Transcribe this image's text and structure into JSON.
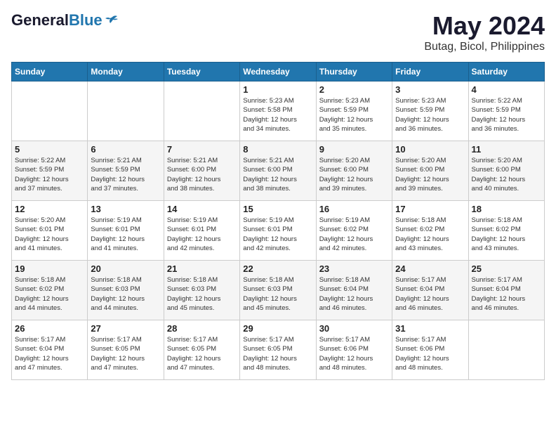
{
  "header": {
    "logo_general": "General",
    "logo_blue": "Blue",
    "title": "May 2024",
    "subtitle": "Butag, Bicol, Philippines"
  },
  "weekdays": [
    "Sunday",
    "Monday",
    "Tuesday",
    "Wednesday",
    "Thursday",
    "Friday",
    "Saturday"
  ],
  "weeks": [
    [
      {
        "day": "",
        "info": ""
      },
      {
        "day": "",
        "info": ""
      },
      {
        "day": "",
        "info": ""
      },
      {
        "day": "1",
        "info": "Sunrise: 5:23 AM\nSunset: 5:58 PM\nDaylight: 12 hours\nand 34 minutes."
      },
      {
        "day": "2",
        "info": "Sunrise: 5:23 AM\nSunset: 5:59 PM\nDaylight: 12 hours\nand 35 minutes."
      },
      {
        "day": "3",
        "info": "Sunrise: 5:23 AM\nSunset: 5:59 PM\nDaylight: 12 hours\nand 36 minutes."
      },
      {
        "day": "4",
        "info": "Sunrise: 5:22 AM\nSunset: 5:59 PM\nDaylight: 12 hours\nand 36 minutes."
      }
    ],
    [
      {
        "day": "5",
        "info": "Sunrise: 5:22 AM\nSunset: 5:59 PM\nDaylight: 12 hours\nand 37 minutes."
      },
      {
        "day": "6",
        "info": "Sunrise: 5:21 AM\nSunset: 5:59 PM\nDaylight: 12 hours\nand 37 minutes."
      },
      {
        "day": "7",
        "info": "Sunrise: 5:21 AM\nSunset: 6:00 PM\nDaylight: 12 hours\nand 38 minutes."
      },
      {
        "day": "8",
        "info": "Sunrise: 5:21 AM\nSunset: 6:00 PM\nDaylight: 12 hours\nand 38 minutes."
      },
      {
        "day": "9",
        "info": "Sunrise: 5:20 AM\nSunset: 6:00 PM\nDaylight: 12 hours\nand 39 minutes."
      },
      {
        "day": "10",
        "info": "Sunrise: 5:20 AM\nSunset: 6:00 PM\nDaylight: 12 hours\nand 39 minutes."
      },
      {
        "day": "11",
        "info": "Sunrise: 5:20 AM\nSunset: 6:00 PM\nDaylight: 12 hours\nand 40 minutes."
      }
    ],
    [
      {
        "day": "12",
        "info": "Sunrise: 5:20 AM\nSunset: 6:01 PM\nDaylight: 12 hours\nand 41 minutes."
      },
      {
        "day": "13",
        "info": "Sunrise: 5:19 AM\nSunset: 6:01 PM\nDaylight: 12 hours\nand 41 minutes."
      },
      {
        "day": "14",
        "info": "Sunrise: 5:19 AM\nSunset: 6:01 PM\nDaylight: 12 hours\nand 42 minutes."
      },
      {
        "day": "15",
        "info": "Sunrise: 5:19 AM\nSunset: 6:01 PM\nDaylight: 12 hours\nand 42 minutes."
      },
      {
        "day": "16",
        "info": "Sunrise: 5:19 AM\nSunset: 6:02 PM\nDaylight: 12 hours\nand 42 minutes."
      },
      {
        "day": "17",
        "info": "Sunrise: 5:18 AM\nSunset: 6:02 PM\nDaylight: 12 hours\nand 43 minutes."
      },
      {
        "day": "18",
        "info": "Sunrise: 5:18 AM\nSunset: 6:02 PM\nDaylight: 12 hours\nand 43 minutes."
      }
    ],
    [
      {
        "day": "19",
        "info": "Sunrise: 5:18 AM\nSunset: 6:02 PM\nDaylight: 12 hours\nand 44 minutes."
      },
      {
        "day": "20",
        "info": "Sunrise: 5:18 AM\nSunset: 6:03 PM\nDaylight: 12 hours\nand 44 minutes."
      },
      {
        "day": "21",
        "info": "Sunrise: 5:18 AM\nSunset: 6:03 PM\nDaylight: 12 hours\nand 45 minutes."
      },
      {
        "day": "22",
        "info": "Sunrise: 5:18 AM\nSunset: 6:03 PM\nDaylight: 12 hours\nand 45 minutes."
      },
      {
        "day": "23",
        "info": "Sunrise: 5:18 AM\nSunset: 6:04 PM\nDaylight: 12 hours\nand 46 minutes."
      },
      {
        "day": "24",
        "info": "Sunrise: 5:17 AM\nSunset: 6:04 PM\nDaylight: 12 hours\nand 46 minutes."
      },
      {
        "day": "25",
        "info": "Sunrise: 5:17 AM\nSunset: 6:04 PM\nDaylight: 12 hours\nand 46 minutes."
      }
    ],
    [
      {
        "day": "26",
        "info": "Sunrise: 5:17 AM\nSunset: 6:04 PM\nDaylight: 12 hours\nand 47 minutes."
      },
      {
        "day": "27",
        "info": "Sunrise: 5:17 AM\nSunset: 6:05 PM\nDaylight: 12 hours\nand 47 minutes."
      },
      {
        "day": "28",
        "info": "Sunrise: 5:17 AM\nSunset: 6:05 PM\nDaylight: 12 hours\nand 47 minutes."
      },
      {
        "day": "29",
        "info": "Sunrise: 5:17 AM\nSunset: 6:05 PM\nDaylight: 12 hours\nand 48 minutes."
      },
      {
        "day": "30",
        "info": "Sunrise: 5:17 AM\nSunset: 6:06 PM\nDaylight: 12 hours\nand 48 minutes."
      },
      {
        "day": "31",
        "info": "Sunrise: 5:17 AM\nSunset: 6:06 PM\nDaylight: 12 hours\nand 48 minutes."
      },
      {
        "day": "",
        "info": ""
      }
    ]
  ]
}
